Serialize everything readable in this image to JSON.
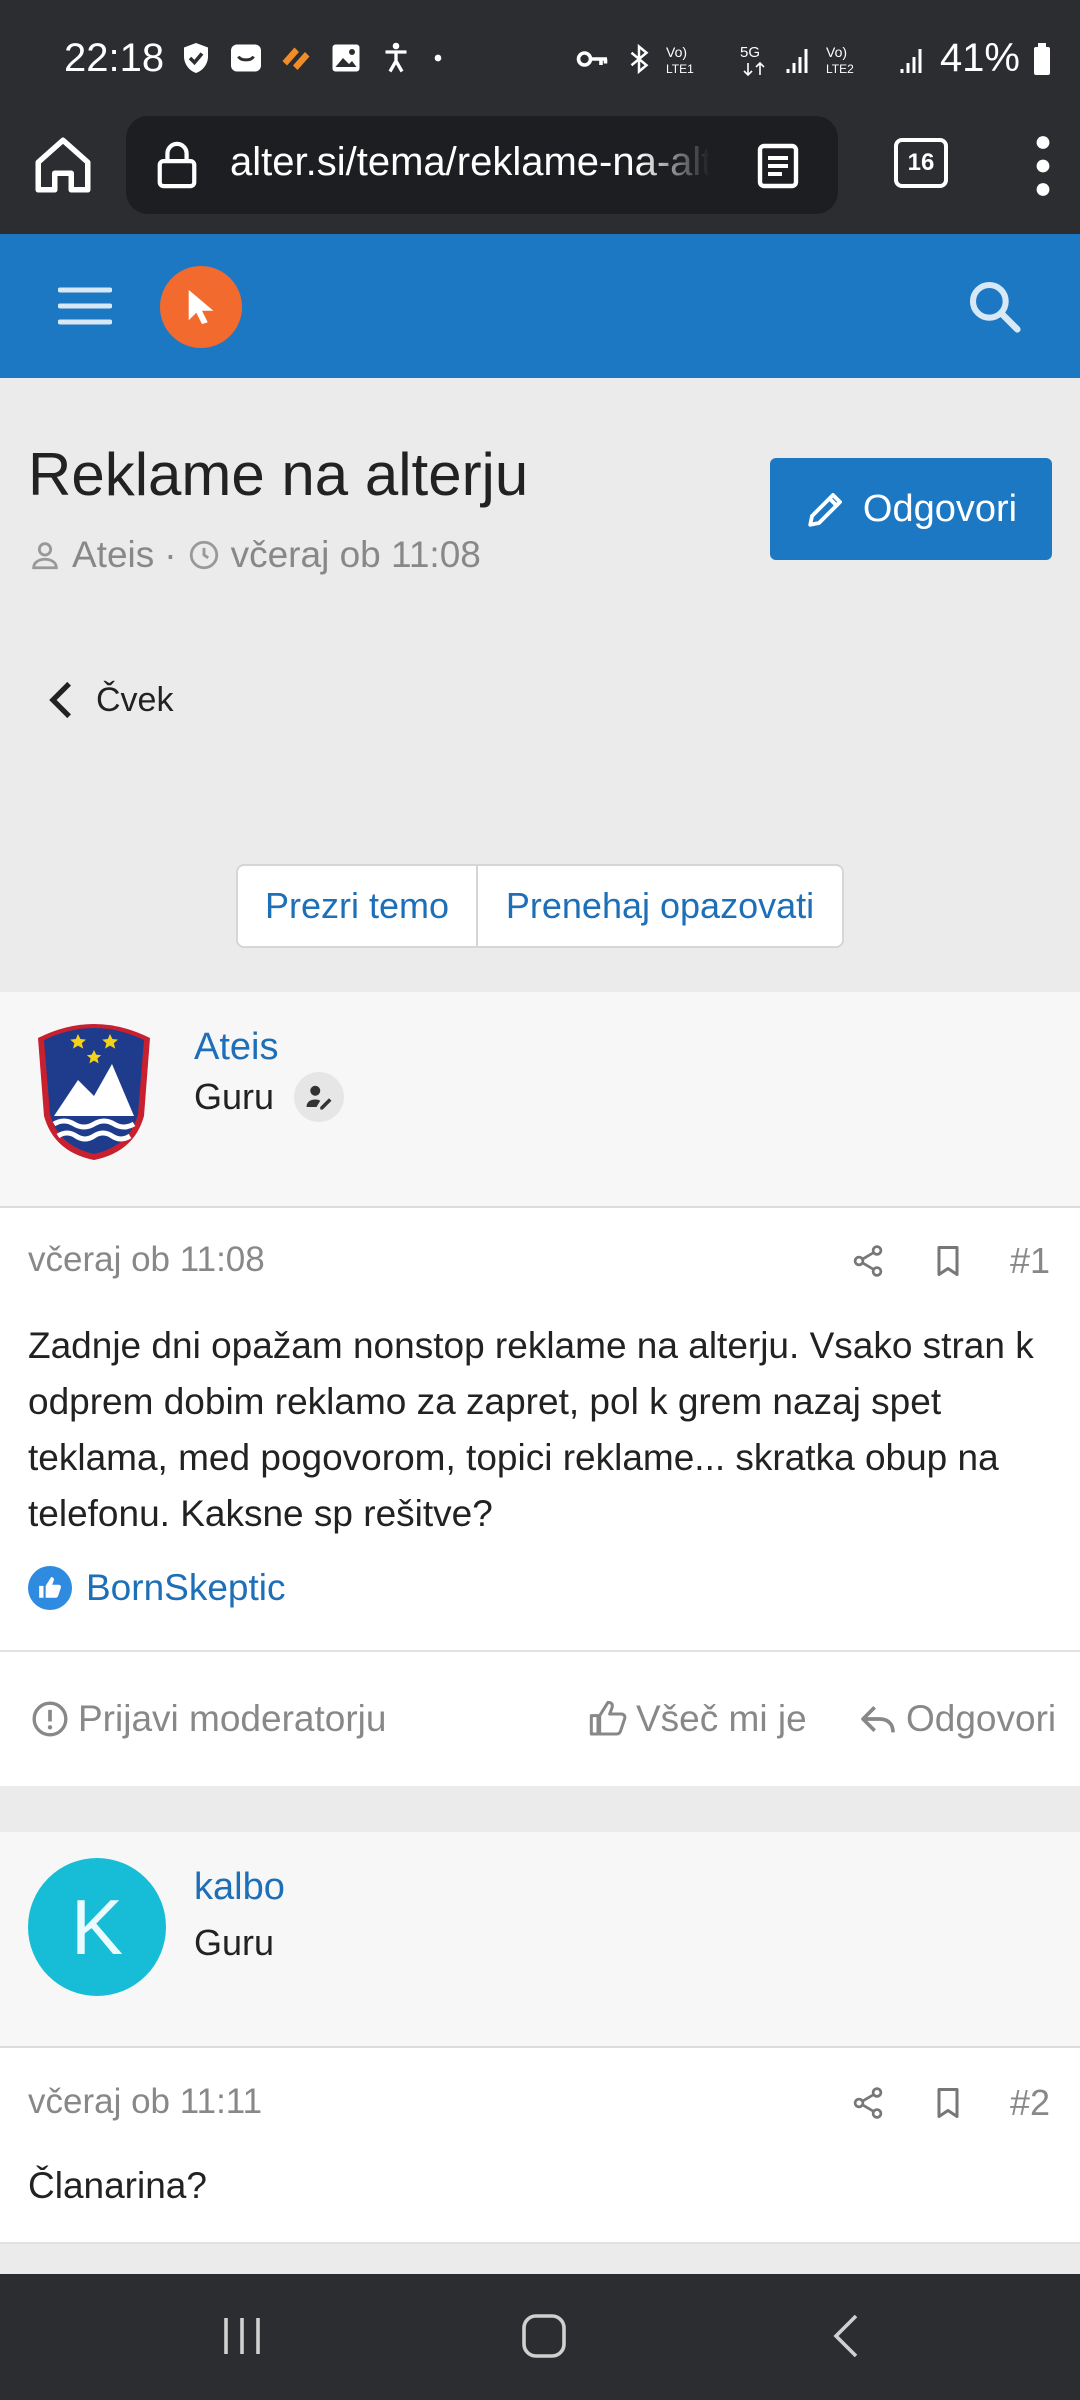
{
  "status_bar": {
    "time": "22:18",
    "battery": "41%",
    "sim1": "LTE1",
    "sim2": "LTE2",
    "network": "5G"
  },
  "browser": {
    "url": "alter.si/tema/reklame-na-alterju",
    "tab_count": "16"
  },
  "topic": {
    "title": "Reklame na alterju",
    "author": "Ateis",
    "separator": "·",
    "time": "včeraj ob 11:08",
    "reply_button": "Odgovori",
    "back_label": "Čvek",
    "ignore_button": "Prezri temo",
    "unwatch_button": "Prenehaj opazovati"
  },
  "posts": [
    {
      "author": "Ateis",
      "role": "Guru",
      "date": "včeraj ob 11:08",
      "number": "#1",
      "body": "Zadnje dni opažam nonstop reklame na alterju. Vsako stran k odprem dobim reklamo za zapret, pol k grem nazaj spet teklama, med pogovorom, topici reklame... skratka obup na telefonu. Kaksne sp rešitve?",
      "liked_by": "BornSkeptic",
      "report": "Prijavi moderatorju",
      "like": "Všeč mi je",
      "reply": "Odgovori"
    },
    {
      "author": "kalbo",
      "avatar_letter": "K",
      "role": "Guru",
      "date": "včeraj ob 11:11",
      "number": "#2",
      "body": "Članarina?"
    }
  ],
  "colors": {
    "brand_blue": "#1d78c4",
    "link_blue": "#1d6fb8",
    "logo_orange": "#f26a2e",
    "avatar_cyan": "#17bdd6",
    "dark_chrome": "#2c2d31"
  }
}
